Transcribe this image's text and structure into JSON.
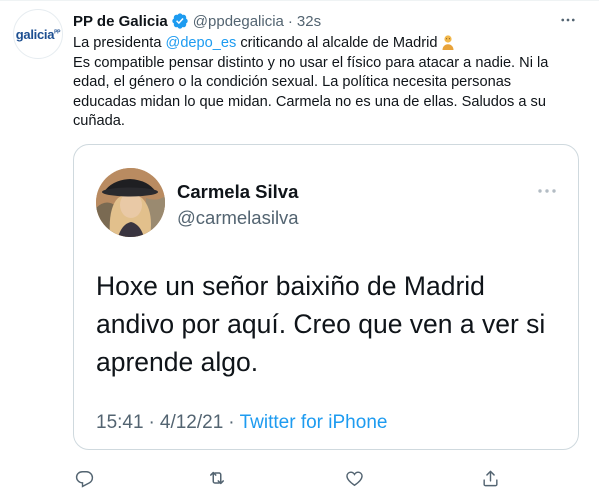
{
  "tweet": {
    "avatar_logo": "galicia",
    "avatar_logo_mark": "PP",
    "display_name": "PP de Galicia",
    "handle": "@ppdegalicia",
    "separator": "·",
    "time": "32s",
    "text_line1_prefix": "La presidenta ",
    "mention": "@depo_es",
    "text_line1_suffix": " criticando al alcalde de Madrid",
    "text_rest": "Es compatible pensar distinto y no usar el físico para atacar a nadie. Ni la edad, el género o la condición sexual. La política necesita personas educadas midan lo que midan. Carmela no es una de ellas. Saludos a su cuñada.",
    "emoji": "person-emoji",
    "verified_icon": "verified-badge-icon",
    "more_icon": "more-icon"
  },
  "quote": {
    "name": "Carmela Silva",
    "handle": "@carmelasilva",
    "text": "Hoxe un señor baixiño de Madrid andivo por aquí. Creo que ven a ver si aprende algo.",
    "time": "15:41",
    "sep": "·",
    "date": "4/12/21",
    "sep2": "·",
    "source": "Twitter for iPhone",
    "more_icon": "more-icon"
  },
  "actions": [
    {
      "name": "reply",
      "icon": "reply-icon"
    },
    {
      "name": "retweet",
      "icon": "retweet-icon"
    },
    {
      "name": "like",
      "icon": "heart-icon"
    },
    {
      "name": "share",
      "icon": "share-icon"
    }
  ],
  "colors": {
    "accent": "#1d9bf0",
    "text": "#0f1419",
    "secondary": "#536471",
    "border": "#cfd9de"
  }
}
